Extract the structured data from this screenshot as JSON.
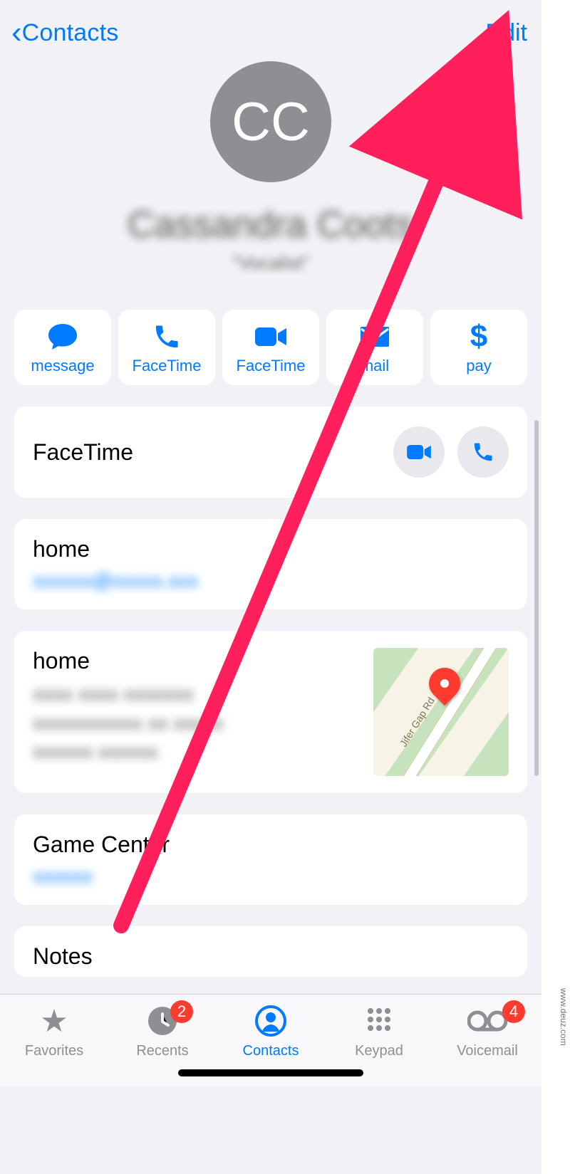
{
  "nav": {
    "back_label": "Contacts",
    "edit_label": "Edit"
  },
  "contact": {
    "initials": "CC",
    "name": "Cassandra Coots",
    "subtitle": "\"Vocalist\""
  },
  "actions": {
    "message": "message",
    "facetime_audio": "FaceTime",
    "facetime_video": "FaceTime",
    "mail": "mail",
    "pay": "pay"
  },
  "cards": {
    "facetime_label": "FaceTime",
    "email_label": "home",
    "email_value": "xxxxxx@xxxxx.xxx",
    "address_label": "home",
    "address_lines": "xxxx xxxx xxxxxxx\nxxxxxxxxxxx xx xxxxx\nxxxxxx xxxxxx",
    "map_road": "Jifer Gap Rd",
    "gamecenter_label": "Game Center",
    "gamecenter_value": "xxxxxx",
    "notes_label": "Notes"
  },
  "tabs": {
    "favorites": "Favorites",
    "recents": "Recents",
    "recents_badge": "2",
    "contacts": "Contacts",
    "keypad": "Keypad",
    "voicemail": "Voicemail",
    "voicemail_badge": "4"
  },
  "watermark": "www.deuz.com",
  "colors": {
    "accent": "#007aff",
    "badge": "#ff3b30"
  }
}
